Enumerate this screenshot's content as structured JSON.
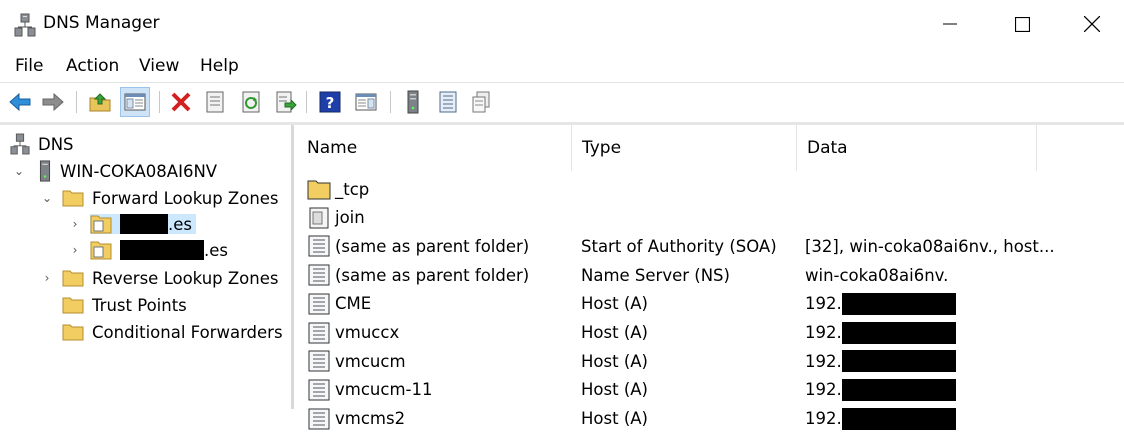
{
  "window": {
    "title": "DNS Manager",
    "controls": {
      "minimize": "—",
      "maximize": "☐",
      "close": "✕"
    }
  },
  "menu": [
    "File",
    "Action",
    "View",
    "Help"
  ],
  "toolbar": {
    "buttons": [
      {
        "name": "back-icon"
      },
      {
        "name": "forward-icon"
      },
      {
        "name": "up-folder-icon"
      },
      {
        "name": "show-hide-tree-icon",
        "active": true
      },
      {
        "name": "delete-icon"
      },
      {
        "name": "properties-icon"
      },
      {
        "name": "refresh-icon"
      },
      {
        "name": "export-list-icon"
      },
      {
        "name": "help-icon"
      },
      {
        "name": "action-pane-icon"
      },
      {
        "name": "server-icon"
      },
      {
        "name": "zone-list-icon"
      },
      {
        "name": "records-icon"
      }
    ]
  },
  "tree": {
    "root": "DNS",
    "server": "WIN-COKA08AI6NV",
    "forward_zones": "Forward Lookup Zones",
    "zone1_suffix": ".es",
    "zone2_suffix": ".es",
    "reverse_zones": "Reverse Lookup Zones",
    "trust_points": "Trust Points",
    "conditional_forwarders": "Conditional Forwarders"
  },
  "columns": {
    "name": "Name",
    "type": "Type",
    "data": "Data"
  },
  "records": [
    {
      "name": "_tcp",
      "type": "",
      "data": "",
      "icon": "folder-icon"
    },
    {
      "name": "join",
      "type": "",
      "data": "",
      "icon": "delegation-icon"
    },
    {
      "name": "(same as parent folder)",
      "type": "Start of Authority (SOA)",
      "data": "[32], win-coka08ai6nv., host...",
      "icon": "record-icon"
    },
    {
      "name": "(same as parent folder)",
      "type": "Name Server (NS)",
      "data": "win-coka08ai6nv.",
      "icon": "record-icon"
    },
    {
      "name": "CME",
      "type": "Host (A)",
      "data": "192.",
      "icon": "record-icon",
      "redacted": true
    },
    {
      "name": "vmuccx",
      "type": "Host (A)",
      "data": "192.",
      "icon": "record-icon",
      "redacted": true
    },
    {
      "name": "vmcucm",
      "type": "Host (A)",
      "data": "192.",
      "icon": "record-icon",
      "redacted": true
    },
    {
      "name": "vmcucm-11",
      "type": "Host (A)",
      "data": "192.",
      "icon": "record-icon",
      "redacted": true
    },
    {
      "name": "vmcms2",
      "type": "Host (A)",
      "data": "192.",
      "icon": "record-icon",
      "redacted": true
    }
  ]
}
